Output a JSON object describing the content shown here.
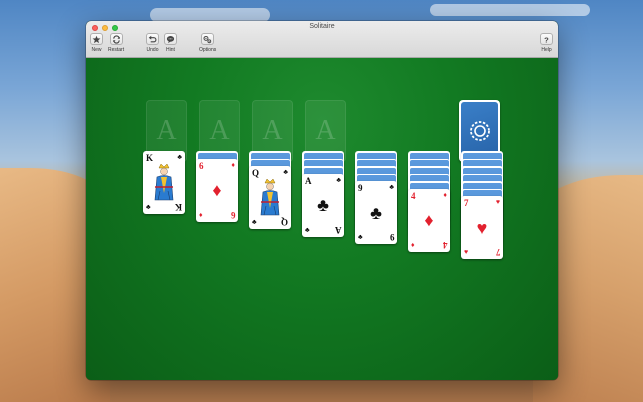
{
  "window": {
    "title": "Solitaire"
  },
  "toolbar": {
    "new_label": "New",
    "restart_label": "Restart",
    "undo_label": "Undo",
    "hint_label": "Hint",
    "options_label": "Options",
    "help_label": "Help"
  },
  "icons": {
    "new": "star-icon",
    "restart": "restart-icon",
    "undo": "undo-icon",
    "hint": "hint-icon",
    "options": "options-icon",
    "help": "help-icon"
  },
  "colors": {
    "felt": "#127a22",
    "card_back": "#3c7ec6",
    "red_suit": "#e2212e",
    "black_suit": "#111111"
  },
  "foundations": [
    {
      "label": "A"
    },
    {
      "label": "A"
    },
    {
      "label": "A"
    },
    {
      "label": "A"
    }
  ],
  "stock": {
    "face_down": true
  },
  "tableau": [
    {
      "hidden": 0,
      "top": {
        "rank": "K",
        "suit": "♣",
        "color": "black",
        "face_card": true
      }
    },
    {
      "hidden": 1,
      "top": {
        "rank": "6",
        "suit": "♦",
        "color": "red",
        "face_card": false
      }
    },
    {
      "hidden": 2,
      "top": {
        "rank": "Q",
        "suit": "♣",
        "color": "black",
        "face_card": true
      }
    },
    {
      "hidden": 3,
      "top": {
        "rank": "A",
        "suit": "♣",
        "color": "black",
        "face_card": false
      }
    },
    {
      "hidden": 4,
      "top": {
        "rank": "9",
        "suit": "♣",
        "color": "black",
        "face_card": false
      }
    },
    {
      "hidden": 5,
      "top": {
        "rank": "4",
        "suit": "♦",
        "color": "red",
        "face_card": false
      }
    },
    {
      "hidden": 6,
      "top": {
        "rank": "7",
        "suit": "♥",
        "color": "red",
        "face_card": false
      }
    }
  ]
}
